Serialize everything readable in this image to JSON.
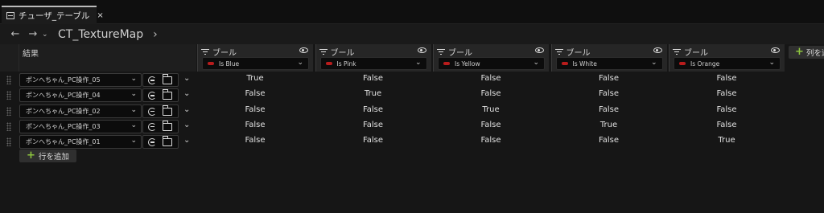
{
  "tab": {
    "label": "チューザ_テーブル",
    "close": "×"
  },
  "nav": {
    "back": "←",
    "forward": "→",
    "history": "⌄",
    "path": "CT_TextureMap",
    "path_arrow": "›"
  },
  "header": {
    "result_label": "結果",
    "columns": [
      {
        "type": "ブール",
        "value": "Is Blue"
      },
      {
        "type": "ブール",
        "value": "Is Pink"
      },
      {
        "type": "ブール",
        "value": "Is Yellow"
      },
      {
        "type": "ブール",
        "value": "Is White"
      },
      {
        "type": "ブール",
        "value": "Is Orange"
      }
    ],
    "add_column_label": "列を追加"
  },
  "rows": [
    {
      "result": "ポンへちゃん_PC操作_05",
      "values": [
        "True",
        "False",
        "False",
        "False",
        "False"
      ]
    },
    {
      "result": "ポンへちゃん_PC操作_04",
      "values": [
        "False",
        "True",
        "False",
        "False",
        "False"
      ]
    },
    {
      "result": "ポンへちゃん_PC操作_02",
      "values": [
        "False",
        "False",
        "True",
        "False",
        "False"
      ]
    },
    {
      "result": "ポンへちゃん_PC操作_03",
      "values": [
        "False",
        "False",
        "False",
        "True",
        "False"
      ]
    },
    {
      "result": "ポンへちゃん_PC操作_01",
      "values": [
        "False",
        "False",
        "False",
        "False",
        "True"
      ]
    }
  ],
  "add_row_label": "行を追加",
  "icons": {
    "chevron": "⌄",
    "plus": "+"
  },
  "colors": {
    "bool_pill": "#b81c1c",
    "plus_green": "#8ec63f"
  }
}
